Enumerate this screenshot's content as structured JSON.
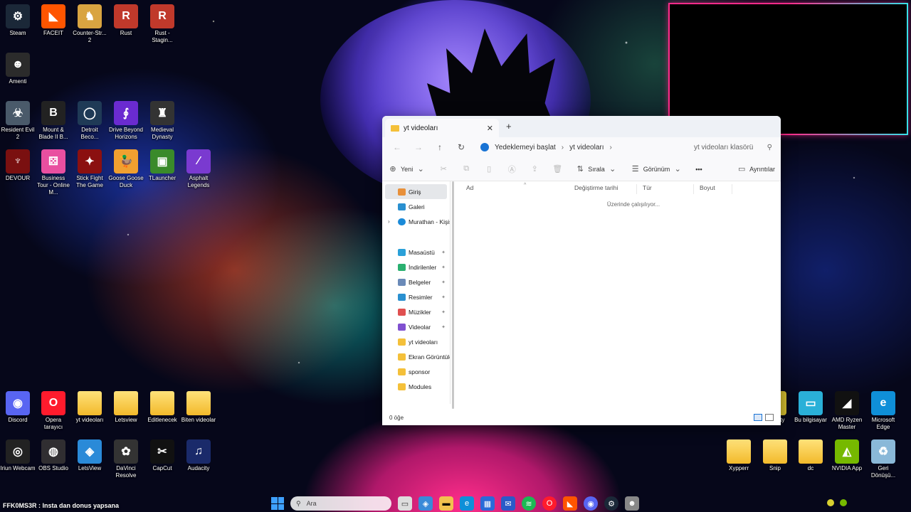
{
  "desktop": {
    "icons_left": [
      {
        "label": "Steam",
        "color": "#1b2838",
        "glyph": "⚙"
      },
      {
        "label": "FACEIT",
        "color": "#ff5500",
        "glyph": "◣"
      },
      {
        "label": "Counter-Str... 2",
        "color": "#d9a441",
        "glyph": "♞"
      },
      {
        "label": "Rust",
        "color": "#c0392b",
        "glyph": "R"
      },
      {
        "label": "Rust - Stagin...",
        "color": "#c0392b",
        "glyph": "R"
      },
      {
        "label": "Amenti",
        "color": "#2b2b2b",
        "glyph": "☻"
      },
      {
        "label": "Resident Evil 2",
        "color": "#4a5a6a",
        "glyph": "☣"
      },
      {
        "label": "Mount & Blade II B...",
        "color": "#222",
        "glyph": "B"
      },
      {
        "label": "Detroit Beco...",
        "color": "#1f3a56",
        "glyph": "◯"
      },
      {
        "label": "Drive Beyond Horizons",
        "color": "#6a2bd0",
        "glyph": "∮"
      },
      {
        "label": "Medieval Dynasty",
        "color": "#333",
        "glyph": "♜"
      },
      {
        "label": "DEVOUR",
        "color": "#7a1010",
        "glyph": "♆"
      },
      {
        "label": "Business Tour - Online M...",
        "color": "#e94fa0",
        "glyph": "⚄"
      },
      {
        "label": "Stick Fight The Game",
        "color": "#8b1010",
        "glyph": "✦"
      },
      {
        "label": "Goose Goose Duck",
        "color": "#f0a030",
        "glyph": "🦆"
      },
      {
        "label": "TLauncher",
        "color": "#3a8a2a",
        "glyph": "▣"
      },
      {
        "label": "Asphalt Legends",
        "color": "#7a3ad0",
        "glyph": "⁄"
      }
    ],
    "icons_bottom_left": [
      {
        "label": "Discord",
        "color": "#5865f2",
        "glyph": "◉"
      },
      {
        "label": "Opera tarayıcı",
        "color": "#ff1b2d",
        "glyph": "O"
      },
      {
        "label": "yt videoları",
        "color": "",
        "glyph": ""
      },
      {
        "label": "Letsview",
        "color": "",
        "glyph": ""
      },
      {
        "label": "Editlenecek",
        "color": "",
        "glyph": ""
      },
      {
        "label": "Biten videolar",
        "color": "",
        "glyph": ""
      },
      {
        "label": "Iriun Webcam",
        "color": "#222",
        "glyph": "◎"
      },
      {
        "label": "OBS Studio",
        "color": "#302e31",
        "glyph": "◍"
      },
      {
        "label": "LetsView",
        "color": "#2a8ad8",
        "glyph": "◈"
      },
      {
        "label": "DaVinci Resolve",
        "color": "#333",
        "glyph": "✿"
      },
      {
        "label": "CapCut",
        "color": "#111",
        "glyph": "✂"
      },
      {
        "label": "Audacity",
        "color": "#1a2a6a",
        "glyph": "♫"
      }
    ],
    "icons_right": [
      {
        "label": "Security",
        "color": "#d8c030",
        "glyph": "◐"
      },
      {
        "label": "Bu bilgisayar",
        "color": "#2ab0d8",
        "glyph": "▭"
      },
      {
        "label": "AMD Ryzen Master",
        "color": "#111",
        "glyph": "◢"
      },
      {
        "label": "Microsoft Edge",
        "color": "#0f8fd8",
        "glyph": "e"
      },
      {
        "label": "Xypperr",
        "color": "",
        "glyph": ""
      },
      {
        "label": "Snip",
        "color": "",
        "glyph": ""
      },
      {
        "label": "dc",
        "color": "",
        "glyph": ""
      },
      {
        "label": "NVIDIA App",
        "color": "#76b900",
        "glyph": "◭"
      },
      {
        "label": "Geri Dönüşü...",
        "color": "#8ab8d8",
        "glyph": "♻"
      }
    ]
  },
  "explorer": {
    "tab_title": "yt videoları",
    "tab_close": "✕",
    "new_tab": "+",
    "breadcrumb_root": "Yedeklemeyi başlat",
    "breadcrumb_current": "yt videoları",
    "search_placeholder": "yt videoları klasörü",
    "toolbar": {
      "new": "Yeni",
      "sort": "Sırala",
      "view": "Görünüm",
      "more": "•••",
      "details": "Ayrıntılar"
    },
    "nav": {
      "home": "Giriş",
      "gallery": "Galeri",
      "onedrive": "Murathan - Kişis",
      "quick": [
        {
          "label": "Masaüstü",
          "color": "#2aa0d8"
        },
        {
          "label": "İndirilenler",
          "color": "#2ab070"
        },
        {
          "label": "Belgeler",
          "color": "#6a8ab8"
        },
        {
          "label": "Resimler",
          "color": "#2a90d0"
        },
        {
          "label": "Müzikler",
          "color": "#e05050"
        },
        {
          "label": "Videolar",
          "color": "#8050d0"
        }
      ],
      "folders": [
        "yt videoları",
        "Ekran Görüntüle",
        "sponsor",
        "Modules"
      ]
    },
    "columns": {
      "name": "Ad",
      "date": "Değiştirme tarihi",
      "type": "Tür",
      "size": "Boyut"
    },
    "working_text": "Üzerinde çalışılıyor...",
    "status_count": "0 öğe"
  },
  "taskbar": {
    "search_placeholder": "Ara",
    "overlay_text": "FFK0MS3R : Insta dan donus yapsana"
  }
}
